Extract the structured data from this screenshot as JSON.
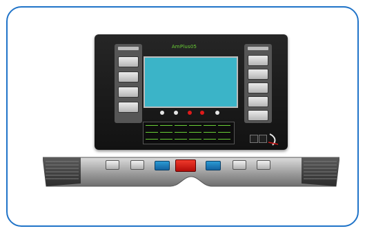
{
  "console": {
    "brand_text": "AmPlus05",
    "colors": {
      "frame_border": "#1f73c8",
      "console_body": "#1c1c1c",
      "screen": "#3bb4c8",
      "display_green": "#6ad136",
      "accent_red": "#e01a1a",
      "accent_blue": "#1f7fc2",
      "keypad_grey": "#c8c8c8"
    },
    "left_panel": {
      "buttons": 4
    },
    "right_panel": {
      "buttons": 5
    },
    "center_keys": [
      "white",
      "white",
      "red",
      "red",
      "white"
    ],
    "matrix": {
      "rows": 3,
      "cols": 6
    },
    "deck_buttons": [
      {
        "name": "grey",
        "color": "grey"
      },
      {
        "name": "grey",
        "color": "grey"
      },
      {
        "name": "blue",
        "color": "blue"
      },
      {
        "name": "red",
        "color": "red"
      },
      {
        "name": "blue",
        "color": "blue"
      },
      {
        "name": "grey",
        "color": "grey"
      },
      {
        "name": "grey",
        "color": "grey"
      }
    ]
  }
}
